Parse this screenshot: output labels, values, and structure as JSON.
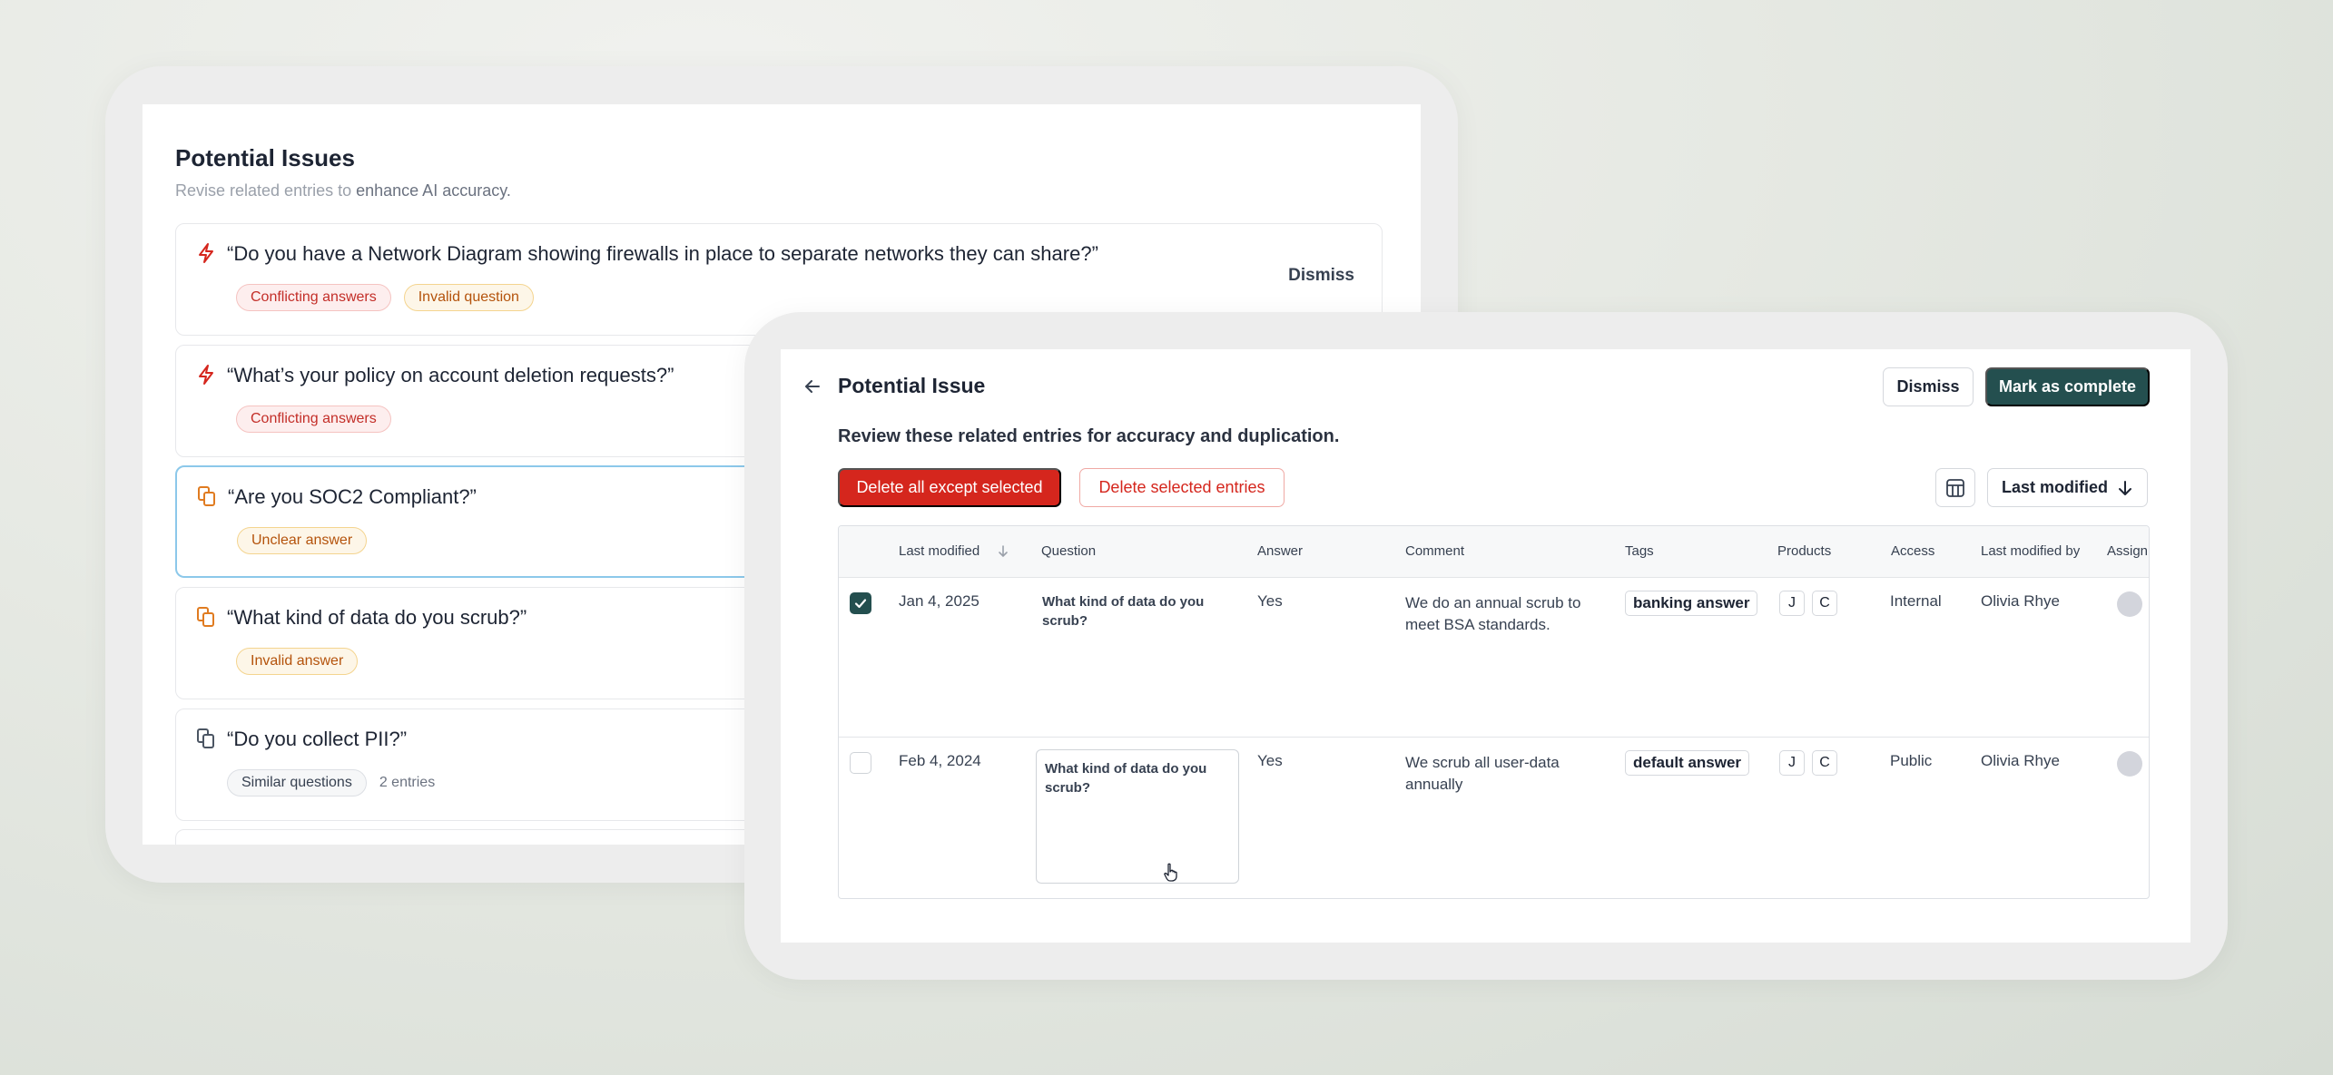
{
  "back_panel": {
    "title": "Potential Issues",
    "subtitle_prefix": "Revise related entries to ",
    "subtitle_emphasis": "enhance AI accuracy.",
    "dismiss_label": "Dismiss",
    "issues": [
      {
        "icon": "lightning-icon",
        "question": "“Do you have a Network Diagram showing firewalls in place to separate networks they can share?”",
        "tags": [
          "Conflicting answers",
          "Invalid question"
        ]
      },
      {
        "icon": "lightning-icon",
        "question": "“What’s your policy on account deletion requests?”",
        "tags": [
          "Conflicting answers"
        ]
      },
      {
        "icon": "copy-icon",
        "question": "“Are you SOC2 Compliant?”",
        "tags": [
          "Unclear answer"
        ]
      },
      {
        "icon": "copy-icon",
        "question": "“What kind of data do you scrub?”",
        "tags": [
          "Invalid answer"
        ]
      },
      {
        "icon": "copy-icon",
        "question": "“Do you collect PII?”",
        "tags": [
          "Similar questions"
        ],
        "extra": "2 entries"
      }
    ]
  },
  "front_panel": {
    "title": "Potential Issue",
    "dismiss_label": "Dismiss",
    "complete_label": "Mark as complete",
    "subtitle": "Review these related entries for accuracy and duplication.",
    "delete_except_label": "Delete all except selected",
    "delete_selected_label": "Delete selected entries",
    "sort_label": "Last modified",
    "table": {
      "headers": [
        "Last modified",
        "Question",
        "Answer",
        "Comment",
        "Tags",
        "Products",
        "Access",
        "Last modified by",
        "Assign"
      ],
      "rows": [
        {
          "checked": true,
          "last_modified": "Jan 4, 2025",
          "question": "What kind of data do you scrub?",
          "answer": "Yes",
          "comment": "We do an annual scrub to meet BSA standards.",
          "tag": "banking answer",
          "products": [
            "J",
            "C"
          ],
          "access": "Internal",
          "modified_by": "Olivia Rhye"
        },
        {
          "checked": false,
          "last_modified": "Feb 4, 2024",
          "question": "What kind of data do you scrub?",
          "answer": "Yes",
          "comment": "We scrub all user-data annually",
          "tag": "default answer",
          "products": [
            "J",
            "C"
          ],
          "access": "Public",
          "modified_by": "Olivia Rhye"
        }
      ]
    }
  },
  "colors": {
    "primary": "#244f4f",
    "danger": "#d5261d",
    "selected_border": "#8cc8ea"
  }
}
